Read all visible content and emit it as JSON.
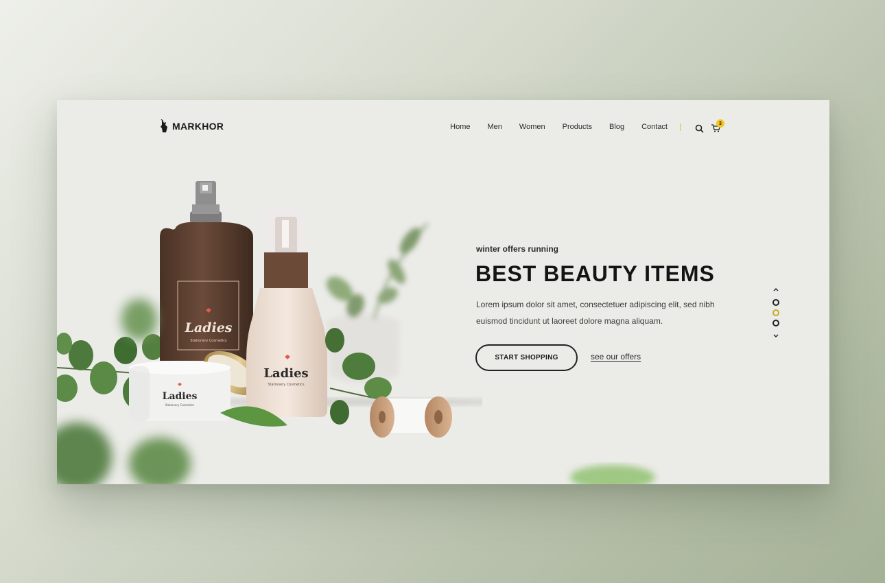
{
  "brand": {
    "name": "MARKHOR"
  },
  "nav": {
    "items": [
      "Home",
      "Men",
      "Women",
      "Products",
      "Blog",
      "Contact"
    ],
    "cart_count": "3",
    "accent_color": "#f3c623"
  },
  "hero": {
    "eyebrow": "winter offers running",
    "title": "BEST BEAUTY ITEMS",
    "description": "Lorem ipsum dolor sit amet, consectetuer adipiscing elit, sed nibh euismod tincidunt ut laoreet dolore magna aliquam.",
    "primary_button": "START SHOPPING",
    "secondary_link": "see our offers"
  },
  "slider": {
    "slides": 3,
    "active_index": 1
  },
  "products": {
    "label": "Ladies",
    "sublabel": "Stationery Cosmetics"
  }
}
